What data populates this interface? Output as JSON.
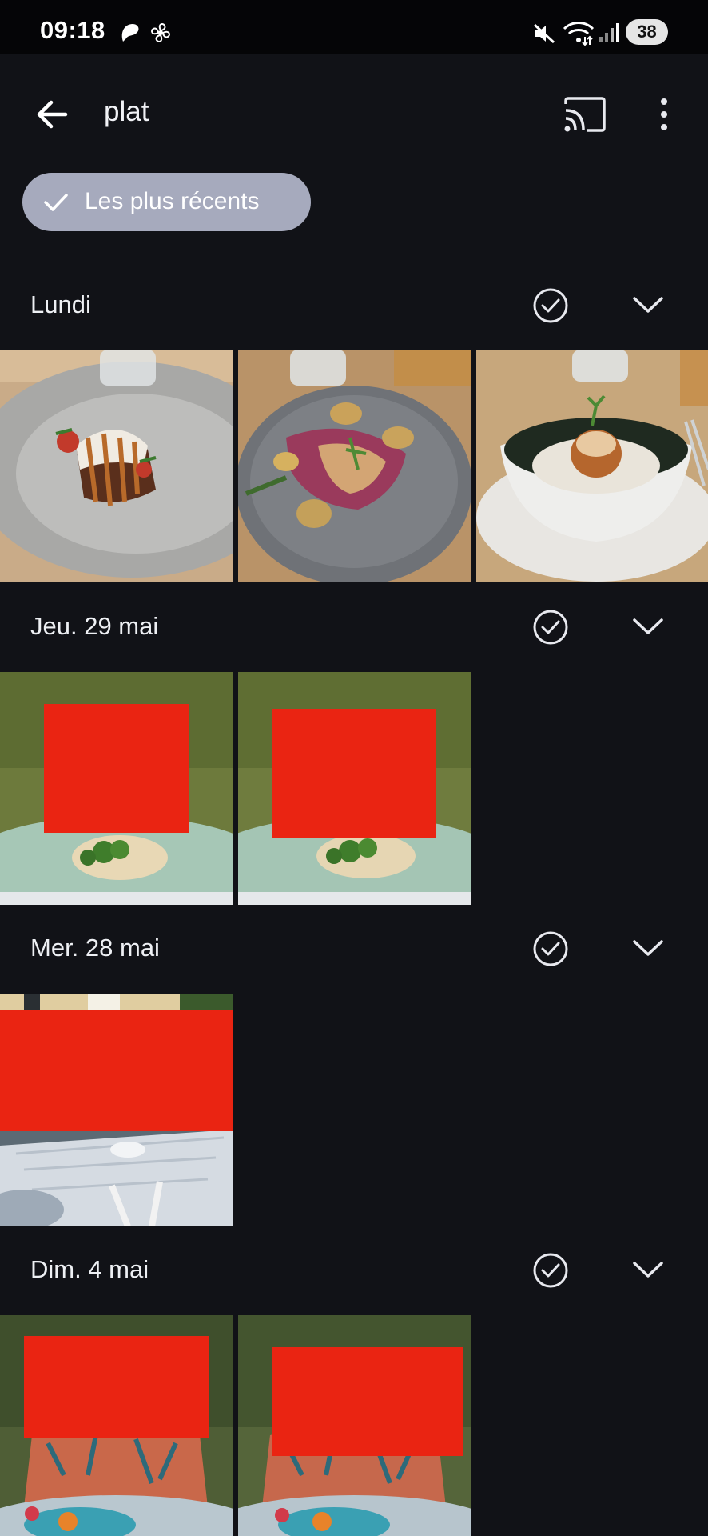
{
  "status_bar": {
    "time": "09:18",
    "battery": "38",
    "icons": [
      "app-icon",
      "fan-icon",
      "mute-icon",
      "wifi-6-icon",
      "signal-icon",
      "battery-icon"
    ]
  },
  "toolbar": {
    "query": "plat",
    "back_icon": "arrow-left-icon",
    "cast_icon": "cast-icon",
    "more_icon": "more-vertical-icon"
  },
  "filter": {
    "label": "Les plus récents",
    "selected": true
  },
  "sections": [
    {
      "date": "Lundi",
      "photos": [
        "dessert-plate",
        "meat-potatoes-plate",
        "bowl-dish"
      ]
    },
    {
      "date": "Jeu. 29 mai",
      "photos": [
        "child-broccoli-plate-1",
        "child-broccoli-plate-2"
      ]
    },
    {
      "date": "Mer. 28 mai",
      "photos": [
        "garden-table"
      ]
    },
    {
      "date": "Dim. 4 mai",
      "photos": [
        "child-meal-tray-1",
        "child-meal-tray-2"
      ]
    }
  ],
  "colors": {
    "background": "#111217",
    "chip": "#a6aabd",
    "redaction": "#ea2412"
  }
}
